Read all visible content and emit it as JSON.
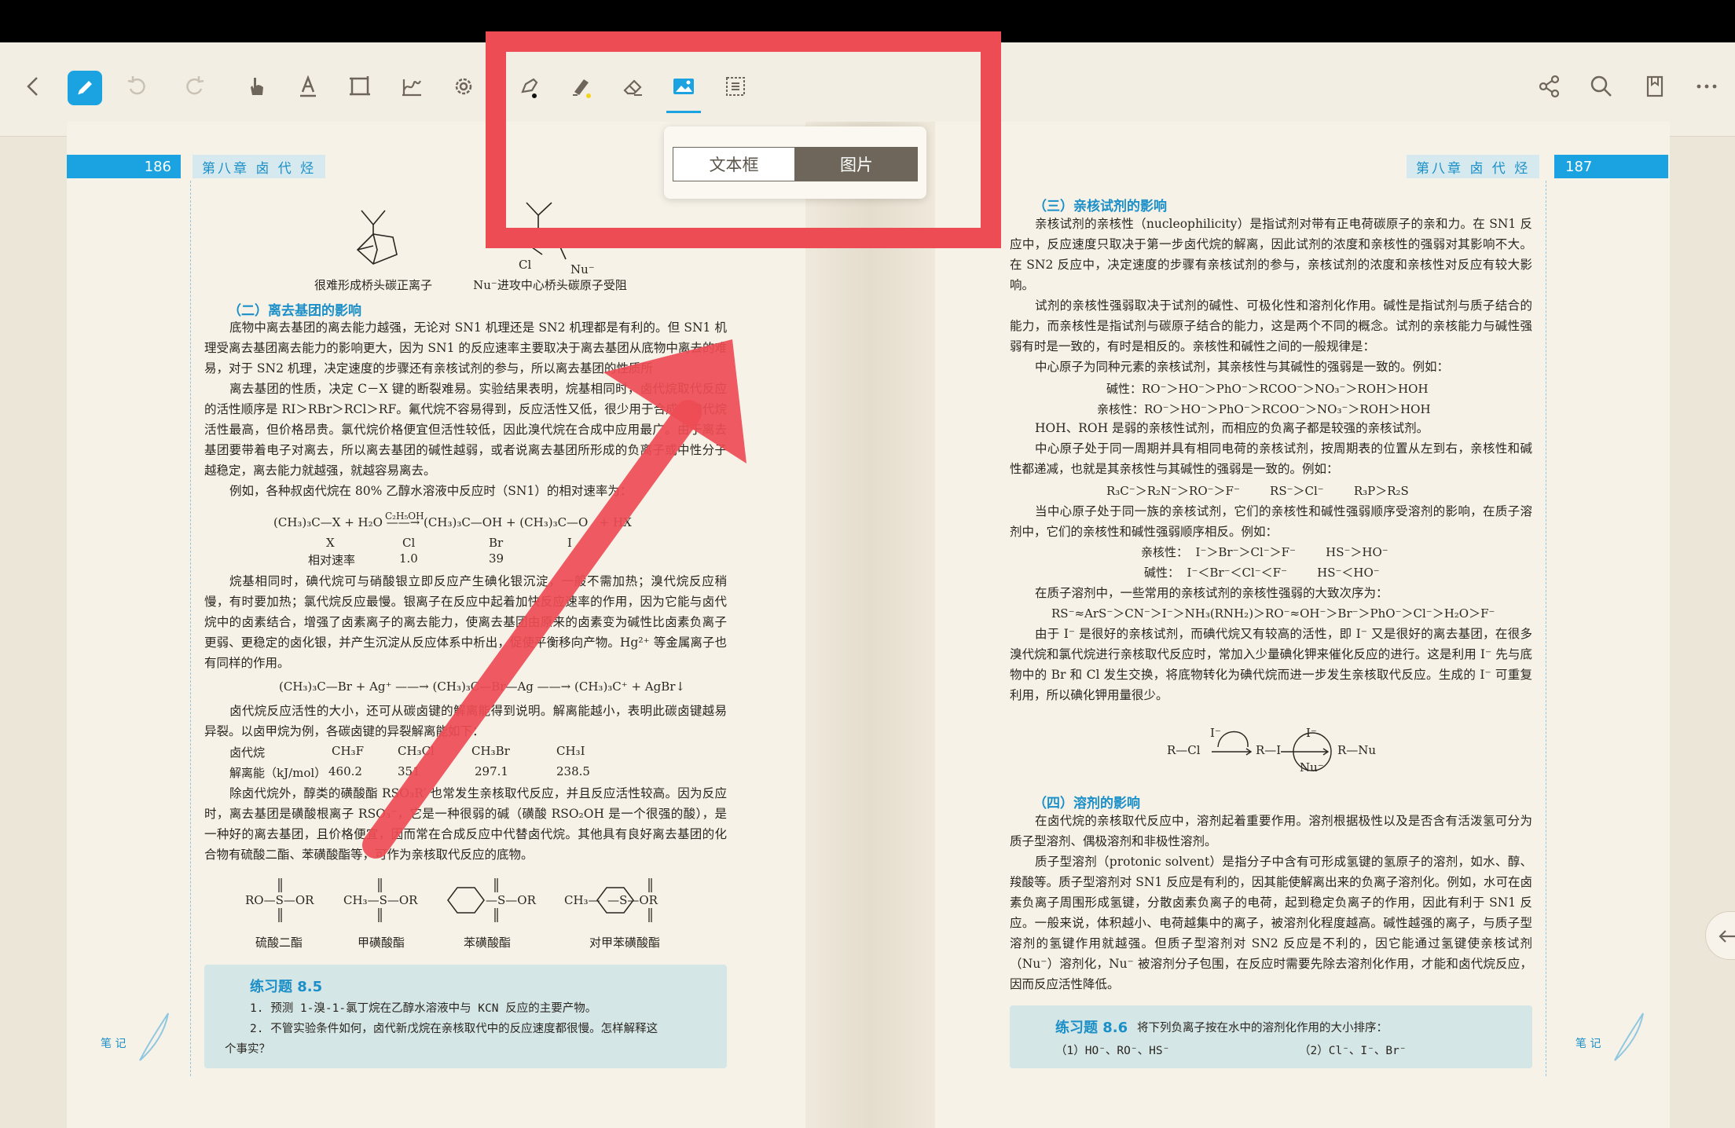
{
  "toolbar": {
    "back_icon": "chevron-left-icon",
    "tools": [
      "pen-icon",
      "undo-icon",
      "redo-icon",
      "hand-icon",
      "text-underline-icon",
      "crop-icon",
      "signature-icon",
      "settings-icon",
      "fountain-pen-icon",
      "highlighter-icon",
      "eraser-icon",
      "image-icon",
      "select-icon"
    ],
    "right_tools": [
      "share-icon",
      "search-icon",
      "bookmark-icon",
      "more-icon"
    ]
  },
  "popup": {
    "text_box": "文本框",
    "picture": "图片"
  },
  "left_page": {
    "page_number": "186",
    "chapter": "第八章 卤 代 烃",
    "caption1": "很难形成桥头碳正离子",
    "caption2": "Nu⁻进攻中心桥头碳原子受阻",
    "cl_label": "Cl",
    "nu_label": "Nu⁻",
    "section": "（二）离去基团的影响",
    "paragraphs": [
      "底物中离去基团的离去能力越强，无论对 SN1 机理还是 SN2 机理都是有利的。但 SN1 机理受离去基团离去能力的影响更大，因为 SN1 的反应速率主要取决于离去基团从底物中离去的难易，对于 SN2 机理，决定速度的步骤还有亲核试剂的参与，所以离去基团的性质所",
      "离去基团的性质，决定 C－X 键的断裂难易。实验结果表明，烷基相同时，卤代烷取代反应的活性顺序是 RI＞RBr＞RCl＞RF。氟代烷不容易得到，反应活性又低，很少用于合成。碘代烷活性最高，但价格昂贵。氯代烷价格便宜但活性较低，因此溴代烷在合成中应用最广。由于离去基团要带着电子对离去，所以离去基团的碱性越弱，或者说离去基团所形成的负离子或中性分子越稳定，离去能力就越强，就越容易离去。",
      "例如，各种叔卤代烷在 80% 乙醇水溶液中反应时（SN1）的相对速率为："
    ],
    "reaction1": "(CH₃)₃C—X + H₂O ——→ (CH₃)₃C—OH + (CH₃)₃C—O   + HX",
    "reaction1_cond": "C₂H₅OH",
    "rate_header": [
      "X",
      "Cl",
      "Br",
      "I"
    ],
    "rate_row_label": "相对速率",
    "rate_values": [
      "1.0",
      "39"
    ],
    "paragraphs2": [
      "烷基相同时，碘代烷可与硝酸银立即反应产生碘化银沉淀，一般不需加热；溴代烷反应稍慢，有时要加热；氯代烷反应最慢。银离子在反应中起着加快反应速率的作用，因为它能与卤代烷中的卤素结合，增强了卤素离子的离去能力，使离去基团由原来的卤素变为碱性比卤素负离子更弱、更稳定的卤化银，并产生沉淀从反应体系中析出，促使平衡移向产物。Hg²⁺ 等金属离子也有同样的作用。"
    ],
    "reaction2": "(CH₃)₃C—Br + Ag⁺ ——→ (CH₃)₃C—Br—Ag ——→ (CH₃)₃C⁺ + AgBr↓",
    "paragraphs3": [
      "卤代烷反应活性的大小，还可从碳卤键的解离能得到说明。解离能越小，表明此碳卤键越易异裂。以卤甲烷为例，各碳卤键的异裂解离能如下："
    ],
    "bde_header": [
      "卤代烷",
      "CH₃F",
      "CH₃Cl",
      "CH₃Br",
      "CH₃I"
    ],
    "bde_label": "解离能（kJ/mol）",
    "bde_values": [
      "460.2",
      "351",
      "297.1",
      "238.5"
    ],
    "paragraphs4": [
      "除卤代烷外，醇类的磺酸酯 RSO₃R′ 也常发生亲核取代反应，并且反应活性较高。因为反应时，离去基团是磺酸根离子 RSO₃⁻，它是一种很弱的碱（磺酸 RSO₂OH 是一个很强的酸），是一种好的离去基团，且价格便宜，因而常在合成反应中代替卤代烷。其他具有良好离去基团的化合物有硫酸二酯、苯磺酸酯等，可作为亲核取代反应的底物。"
    ],
    "struct_labels": [
      "硫酸二酯",
      "甲磺酸酯",
      "苯磺酸酯",
      "对甲苯磺酸酯"
    ],
    "struct_formulas": [
      "RO—S—OR",
      "CH₃—S—OR",
      "—S—OR",
      "CH₃—  —S—OR"
    ],
    "exercise_title": "练习题 8.5",
    "exercise_lines": [
      "1. 预测 1-溴-1-氯丁烷在乙醇水溶液中与 KCN 反应的主要产物。",
      "2. 不管实验条件如何，卤代新戊烷在亲核取代中的反应速度都很慢。怎样解释这",
      "个事实？"
    ],
    "notes_label": "笔 记"
  },
  "right_page": {
    "page_number": "187",
    "chapter": "第八章 卤 代 烃",
    "section3": "（三）亲核试剂的影响",
    "paragraphs": [
      "亲核试剂的亲核性（nucleophilicity）是指试剂对带有正电荷碳原子的亲和力。在 SN1 反应中，反应速度只取决于第一步卤代烷的解离，因此试剂的浓度和亲核性的强弱对其影响不大。在 SN2 反应中，决定速度的步骤有亲核试剂的参与，亲核试剂的浓度和亲核性对反应有较大影响。",
      "试剂的亲核性强弱取决于试剂的碱性、可极化性和溶剂化作用。碱性是指试剂与质子结合的能力，而亲核性是指试剂与碳原子结合的能力，这是两个不同的概念。试剂的亲核能力与碱性强弱有时是一致的，有时是相反的。亲核性和碱性之间的一般规律是：",
      "中心原子为同种元素的亲核试剂，其亲核性与其碱性的强弱是一致的。例如："
    ],
    "order1": "碱性：RO⁻＞HO⁻＞PhO⁻＞RCOO⁻＞NO₃⁻＞ROH＞HOH",
    "order2": "亲核性：RO⁻＞HO⁻＞PhO⁻＞RCOO⁻＞NO₃⁻＞ROH＞HOH",
    "paragraphs2": [
      "HOH、ROH 是弱的亲核性试剂，而相应的负离子都是较强的亲核试剂。",
      "中心原子处于同一周期并具有相同电荷的亲核试剂，按周期表的位置从左到右，亲核性和碱性都递减，也就是其亲核性与其碱性的强弱是一致的。例如："
    ],
    "order3": "R₃C⁻＞R₂N⁻＞RO⁻＞F⁻        RS⁻＞Cl⁻        R₃P＞R₂S",
    "paragraphs3": [
      "当中心原子处于同一族的亲核试剂，它们的亲核性和碱性强弱顺序受溶剂的影响，在质子溶剂中，它们的亲核性和碱性强弱顺序相反。例如："
    ],
    "order4": "亲核性：  I⁻＞Br⁻＞Cl⁻＞F⁻        HS⁻＞HO⁻",
    "order5": "碱性：  I⁻＜Br⁻＜Cl⁻＜F⁻        HS⁻＜HO⁻",
    "paragraphs4": [
      "在质子溶剂中，一些常用的亲核试剂的亲核性强弱的大致次序为："
    ],
    "order6": "RS⁻≈ArS⁻＞CN⁻＞I⁻＞NH₃(RNH₂)＞RO⁻≈OH⁻＞Br⁻＞PhO⁻＞Cl⁻＞H₂O＞F⁻",
    "paragraphs5": [
      "由于 I⁻ 是很好的亲核试剂，而碘代烷又有较高的活性，即 I⁻ 又是很好的离去基团，在很多溴代烷和氯代烷进行亲核取代反应时，常加入少量碘化钾来催化反应的进行。这是利用 I⁻ 先与底物中的 Br 和 Cl 发生交换，将底物转化为碘代烷而进一步发生亲核取代反应。生成的 I⁻ 可重复利用，所以碘化钾用量很少。"
    ],
    "scheme_parts": [
      "R—Cl",
      "I⁻",
      "R—I",
      "I⁻",
      "R—Nu",
      "Nu⁻"
    ],
    "section4": "（四）溶剂的影响",
    "paragraphs6": [
      "在卤代烷的亲核取代反应中，溶剂起着重要作用。溶剂根据极性以及是否含有活泼氢可分为质子型溶剂、偶极溶剂和非极性溶剂。",
      "质子型溶剂（protonic solvent）是指分子中含有可形成氢键的氢原子的溶剂，如水、醇、羧酸等。质子型溶剂对 SN1 反应是有利的，因其能使解离出来的负离子溶剂化。例如，水可在卤素负离子周围形成氢键，分散卤素负离子的电荷，起到稳定负离子的作用，因此有利于 SN1 反应。一般来说，体积越小、电荷越集中的离子，被溶剂化程度越高。碱性越强的离子，与质子型溶剂的氢键作用就越强。但质子型溶剂对 SN2 反应是不利的，因它能通过氢键使亲核试剂（Nu⁻）溶剂化，Nu⁻ 被溶剂分子包围，在反应时需要先除去溶剂化作用，才能和卤代烷反应，因而反应活性降低。"
    ],
    "exercise_title": "练习题 8.6",
    "exercise_prompt": "将下列负离子按在水中的溶剂化作用的大小排序：",
    "exercise_items": [
      "（1）HO⁻、RO⁻、HS⁻",
      "（2）Cl⁻、I⁻、Br⁻"
    ],
    "notes_label": "笔 记"
  },
  "colors": {
    "accent": "#1ba2e0",
    "annotation_red": "#ee4c55",
    "page": "#f6f2e8"
  }
}
